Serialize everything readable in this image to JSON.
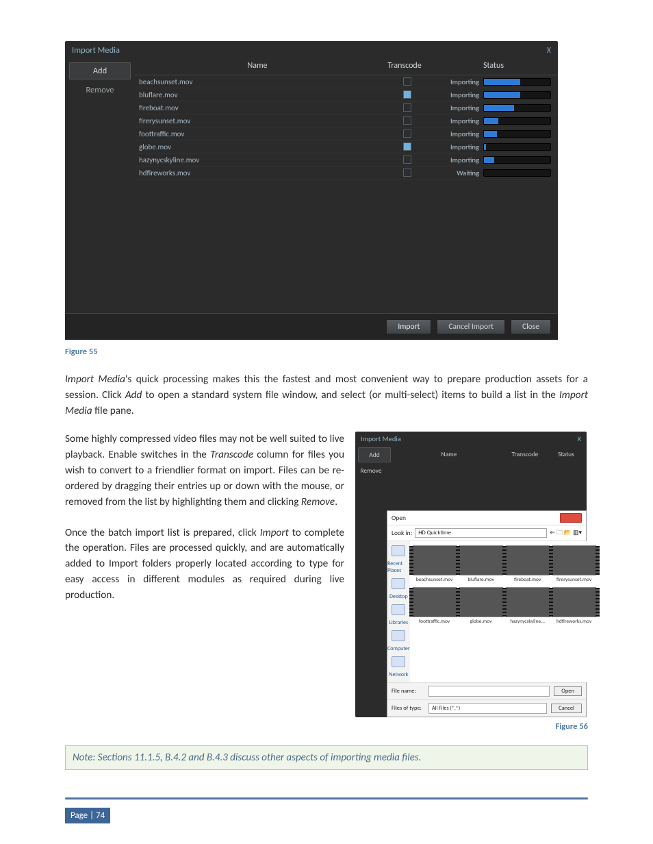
{
  "fig55": {
    "title": "Import Media",
    "close": "X",
    "side": {
      "add": "Add",
      "remove": "Remove"
    },
    "columns": {
      "name": "Name",
      "transcode": "Transcode",
      "status": "Status"
    },
    "rows": [
      {
        "name": "beachsunset.mov",
        "checked": false,
        "status": "Importing",
        "pct": 55
      },
      {
        "name": "bluflare.mov",
        "checked": true,
        "status": "Importing",
        "pct": 55
      },
      {
        "name": "fireboat.mov",
        "checked": false,
        "status": "Importing",
        "pct": 45
      },
      {
        "name": "firerysunset.mov",
        "checked": false,
        "status": "Importing",
        "pct": 22
      },
      {
        "name": "foottraffic.mov",
        "checked": false,
        "status": "Importing",
        "pct": 20
      },
      {
        "name": "globe.mov",
        "checked": true,
        "status": "Importing",
        "pct": 3
      },
      {
        "name": "hazynycskyline.mov",
        "checked": false,
        "status": "Importing",
        "pct": 15
      },
      {
        "name": "hdfireworks.mov",
        "checked": false,
        "status": "Waiting",
        "pct": 0
      }
    ],
    "buttons": {
      "import": "Import",
      "cancel": "Cancel Import",
      "close": "Close"
    },
    "caption": "Figure 55"
  },
  "para1_a": "Import Media",
  "para1_b": "'s quick processing makes this the fastest and most convenient way to prepare production assets for a session. Click ",
  "para1_c": "Add",
  "para1_d": " to open a standard system file window, and select (or multi-select) items to build a list in the ",
  "para1_e": "Import Media",
  "para1_f": " file pane.",
  "para2_a": "Some highly compressed video files may not be well suited to live playback.  Enable switches in the ",
  "para2_b": "Transcode",
  "para2_c": " column for files you wish to convert to a friendlier format on import.  Files can be re-ordered by dragging their entries up or down with the mouse, or removed from the list by highlighting them and clicking ",
  "para2_d": "Remove",
  "para2_e": ".",
  "para3_a": "Once the batch import list is prepared, click ",
  "para3_b": "Import",
  "para3_c": " to complete the operation.  Files are processed quickly, and are automatically added to Import folders properly located according to type for easy access in different modules as required during live production.",
  "fig56": {
    "title": "Import Media",
    "close": "X",
    "side": {
      "add": "Add",
      "remove": "Remove"
    },
    "columns": {
      "name": "Name",
      "transcode": "Transcode",
      "status": "Status"
    },
    "open": {
      "title": "Open",
      "lookin_label": "Look in:",
      "lookin_value": "HD Quicktime",
      "nav_icons": [
        "Recent Places",
        "Desktop",
        "Libraries",
        "Computer",
        "Network"
      ],
      "thumbs": [
        "beachsunset.mov",
        "bluflare.mov",
        "fireboat.mov",
        "firerysunset.mov",
        "foottraffic.mov",
        "globe.mov",
        "hazynycskyline...",
        "hdfireworks.mov"
      ],
      "filename_label": "File name:",
      "filetype_label": "Files of type:",
      "filetype_value": "All Files (*.*)",
      "open_btn": "Open",
      "cancel_btn": "Cancel"
    },
    "caption": "Figure 56"
  },
  "note": "Note: Sections 11.1.5, B.4.2 and B.4.3 discuss other aspects of importing media files.",
  "footer": {
    "page_label": "Page | 74"
  }
}
